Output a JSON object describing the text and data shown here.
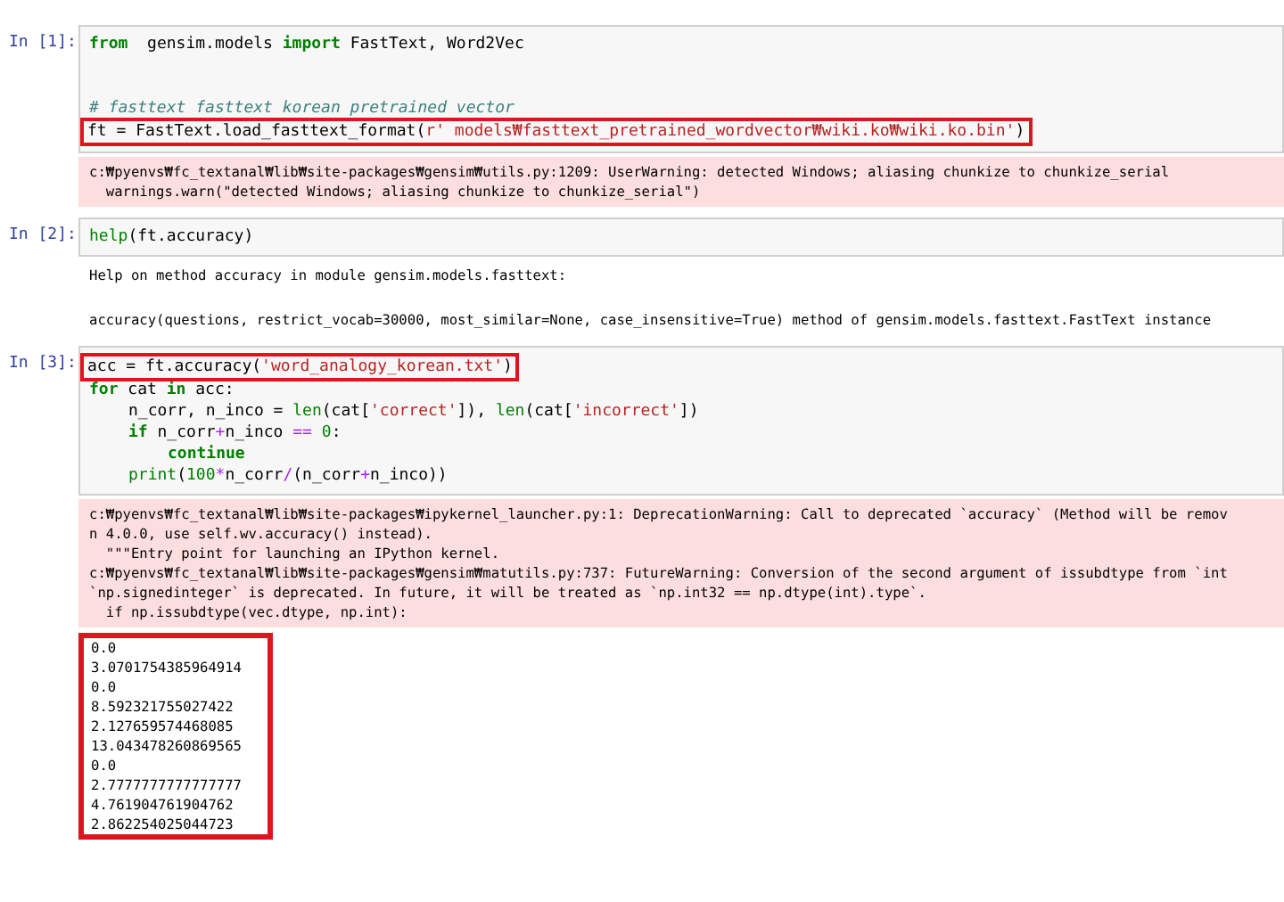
{
  "cells": [
    {
      "prompt": "In [1]:",
      "input": [
        {
          "kind": "code",
          "highlighted": false,
          "tokens": [
            {
              "kind": "keyword",
              "text": "from"
            },
            {
              "kind": "plain",
              "text": "  gensim.models "
            },
            {
              "kind": "keyword",
              "text": "import"
            },
            {
              "kind": "plain",
              "text": " FastText, Word2Vec"
            }
          ]
        },
        {
          "kind": "blank"
        },
        {
          "kind": "blank"
        },
        {
          "kind": "code",
          "highlighted": false,
          "tokens": [
            {
              "kind": "comment",
              "text": "# fasttext fasttext korean pretrained vector"
            }
          ]
        },
        {
          "kind": "code",
          "highlighted": true,
          "tokens": [
            {
              "kind": "plain",
              "text": "ft = FastText.load_fasttext_format("
            },
            {
              "kind": "string",
              "text": "r' models₩fasttext_pretrained_wordvector₩wiki.ko₩wiki.ko.bin'"
            },
            {
              "kind": "plain",
              "text": ")"
            }
          ]
        }
      ],
      "outputs": [
        {
          "kind": "stderr",
          "highlighted": false,
          "lines": [
            "c:₩pyenvs₩fc_textanal₩lib₩site-packages₩gensim₩utils.py:1209: UserWarning: detected Windows; aliasing chunkize to chunkize_serial",
            "  warnings.warn(\"detected Windows; aliasing chunkize to chunkize_serial\")"
          ]
        }
      ]
    },
    {
      "prompt": "In [2]:",
      "input": [
        {
          "kind": "code",
          "highlighted": false,
          "tokens": [
            {
              "kind": "builtin",
              "text": "help"
            },
            {
              "kind": "plain",
              "text": "(ft.accuracy)"
            }
          ]
        }
      ],
      "outputs": [
        {
          "kind": "stdout",
          "highlighted": false,
          "lines": [
            "Help on method accuracy in module gensim.models.fasttext:"
          ]
        },
        {
          "kind": "stdout",
          "highlighted": false,
          "lines": [
            "accuracy(questions, restrict_vocab=30000, most_similar=None, case_insensitive=True) method of gensim.models.fasttext.FastText instance"
          ]
        }
      ]
    },
    {
      "prompt": "In [3]:",
      "input": [
        {
          "kind": "code",
          "highlighted": true,
          "tokens": [
            {
              "kind": "plain",
              "text": "acc = ft.accuracy("
            },
            {
              "kind": "string",
              "text": "'word_analogy_korean.txt'"
            },
            {
              "kind": "plain",
              "text": ")"
            }
          ]
        },
        {
          "kind": "code",
          "highlighted": false,
          "tokens": [
            {
              "kind": "keyword",
              "text": "for"
            },
            {
              "kind": "plain",
              "text": " cat "
            },
            {
              "kind": "keyword",
              "text": "in"
            },
            {
              "kind": "plain",
              "text": " acc:"
            }
          ],
          "children": [
            {
              "kind": "code",
              "highlighted": false,
              "tokens": [
                {
                  "kind": "plain",
                  "text": "n_corr, n_inco = "
                },
                {
                  "kind": "builtin",
                  "text": "len"
                },
                {
                  "kind": "plain",
                  "text": "(cat["
                },
                {
                  "kind": "string",
                  "text": "'correct'"
                },
                {
                  "kind": "plain",
                  "text": "]), "
                },
                {
                  "kind": "builtin",
                  "text": "len"
                },
                {
                  "kind": "plain",
                  "text": "(cat["
                },
                {
                  "kind": "string",
                  "text": "'incorrect'"
                },
                {
                  "kind": "plain",
                  "text": "])"
                }
              ]
            },
            {
              "kind": "code",
              "highlighted": false,
              "tokens": [
                {
                  "kind": "keyword",
                  "text": "if"
                },
                {
                  "kind": "plain",
                  "text": " n_corr"
                },
                {
                  "kind": "operator",
                  "text": "+"
                },
                {
                  "kind": "plain",
                  "text": "n_inco "
                },
                {
                  "kind": "operator",
                  "text": "=="
                },
                {
                  "kind": "number",
                  "text": " 0"
                },
                {
                  "kind": "plain",
                  "text": ":"
                }
              ],
              "children": [
                {
                  "kind": "code",
                  "highlighted": false,
                  "tokens": [
                    {
                      "kind": "keyword",
                      "text": "continue"
                    }
                  ]
                }
              ]
            },
            {
              "kind": "code",
              "highlighted": false,
              "tokens": [
                {
                  "kind": "builtin",
                  "text": "print"
                },
                {
                  "kind": "plain",
                  "text": "("
                },
                {
                  "kind": "number",
                  "text": "100"
                },
                {
                  "kind": "operator",
                  "text": "*"
                },
                {
                  "kind": "plain",
                  "text": "n_corr"
                },
                {
                  "kind": "operator",
                  "text": "/"
                },
                {
                  "kind": "plain",
                  "text": "(n_corr"
                },
                {
                  "kind": "operator",
                  "text": "+"
                },
                {
                  "kind": "plain",
                  "text": "n_inco))"
                }
              ]
            }
          ]
        }
      ],
      "outputs": [
        {
          "kind": "stderr",
          "highlighted": false,
          "lines": [
            "c:₩pyenvs₩fc_textanal₩lib₩site-packages₩ipykernel_launcher.py:1: DeprecationWarning: Call to deprecated `accuracy` (Method will be remov",
            "n 4.0.0, use self.wv.accuracy() instead).",
            "  \"\"\"Entry point for launching an IPython kernel.",
            "c:₩pyenvs₩fc_textanal₩lib₩site-packages₩gensim₩matutils.py:737: FutureWarning: Conversion of the second argument of issubdtype from `int",
            "`np.signedinteger` is deprecated. In future, it will be treated as `np.int32 == np.dtype(int).type`.",
            "  if np.issubdtype(vec.dtype, np.int):"
          ]
        },
        {
          "kind": "stdout",
          "highlighted": true,
          "lines": [
            "0.0",
            "3.0701754385964914",
            "0.0",
            "8.592321755027422",
            "2.127659574468085",
            "13.043478260869565",
            "0.0",
            "2.7777777777777777",
            "4.761904761904762",
            "2.862254025044723"
          ]
        }
      ]
    }
  ]
}
